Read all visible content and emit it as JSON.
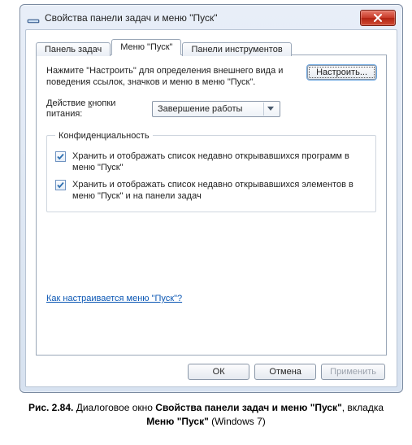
{
  "window": {
    "title": "Свойства панели задач и меню \"Пуск\""
  },
  "tabs": {
    "taskbar": "Панель задач",
    "startmenu": "Меню \"Пуск\"",
    "toolbars": "Панели инструментов"
  },
  "panel": {
    "instruction": "Нажмите \"Настроить\" для определения внешнего вида и поведения ссылок, значков и меню в меню \"Пуск\".",
    "customize_btn": "Настроить...",
    "power_label_pre": "Действие ",
    "power_label_u": "к",
    "power_label_post": "нопки питания:",
    "power_value": "Завершение работы",
    "privacy_legend": "Конфиденциальность",
    "chk_programs": "Хранить и отображать список недавно открывавшихся программ в меню \"Пуск\"",
    "chk_items": "Хранить и отображать список недавно открывавшихся элементов в меню \"Пуск\" и на панели задач",
    "help_link": "Как настраивается меню \"Пуск\"?"
  },
  "buttons": {
    "ok": "ОК",
    "cancel": "Отмена",
    "apply": "Применить"
  },
  "caption": {
    "prefix": "Рис. 2.84. ",
    "text1": "Диалоговое окно ",
    "bold1": "Свойства панели задач и меню \"Пуск\"",
    "text2": ", вкладка ",
    "bold2": "Меню \"Пуск\"",
    "text3": " (Windows 7)"
  }
}
